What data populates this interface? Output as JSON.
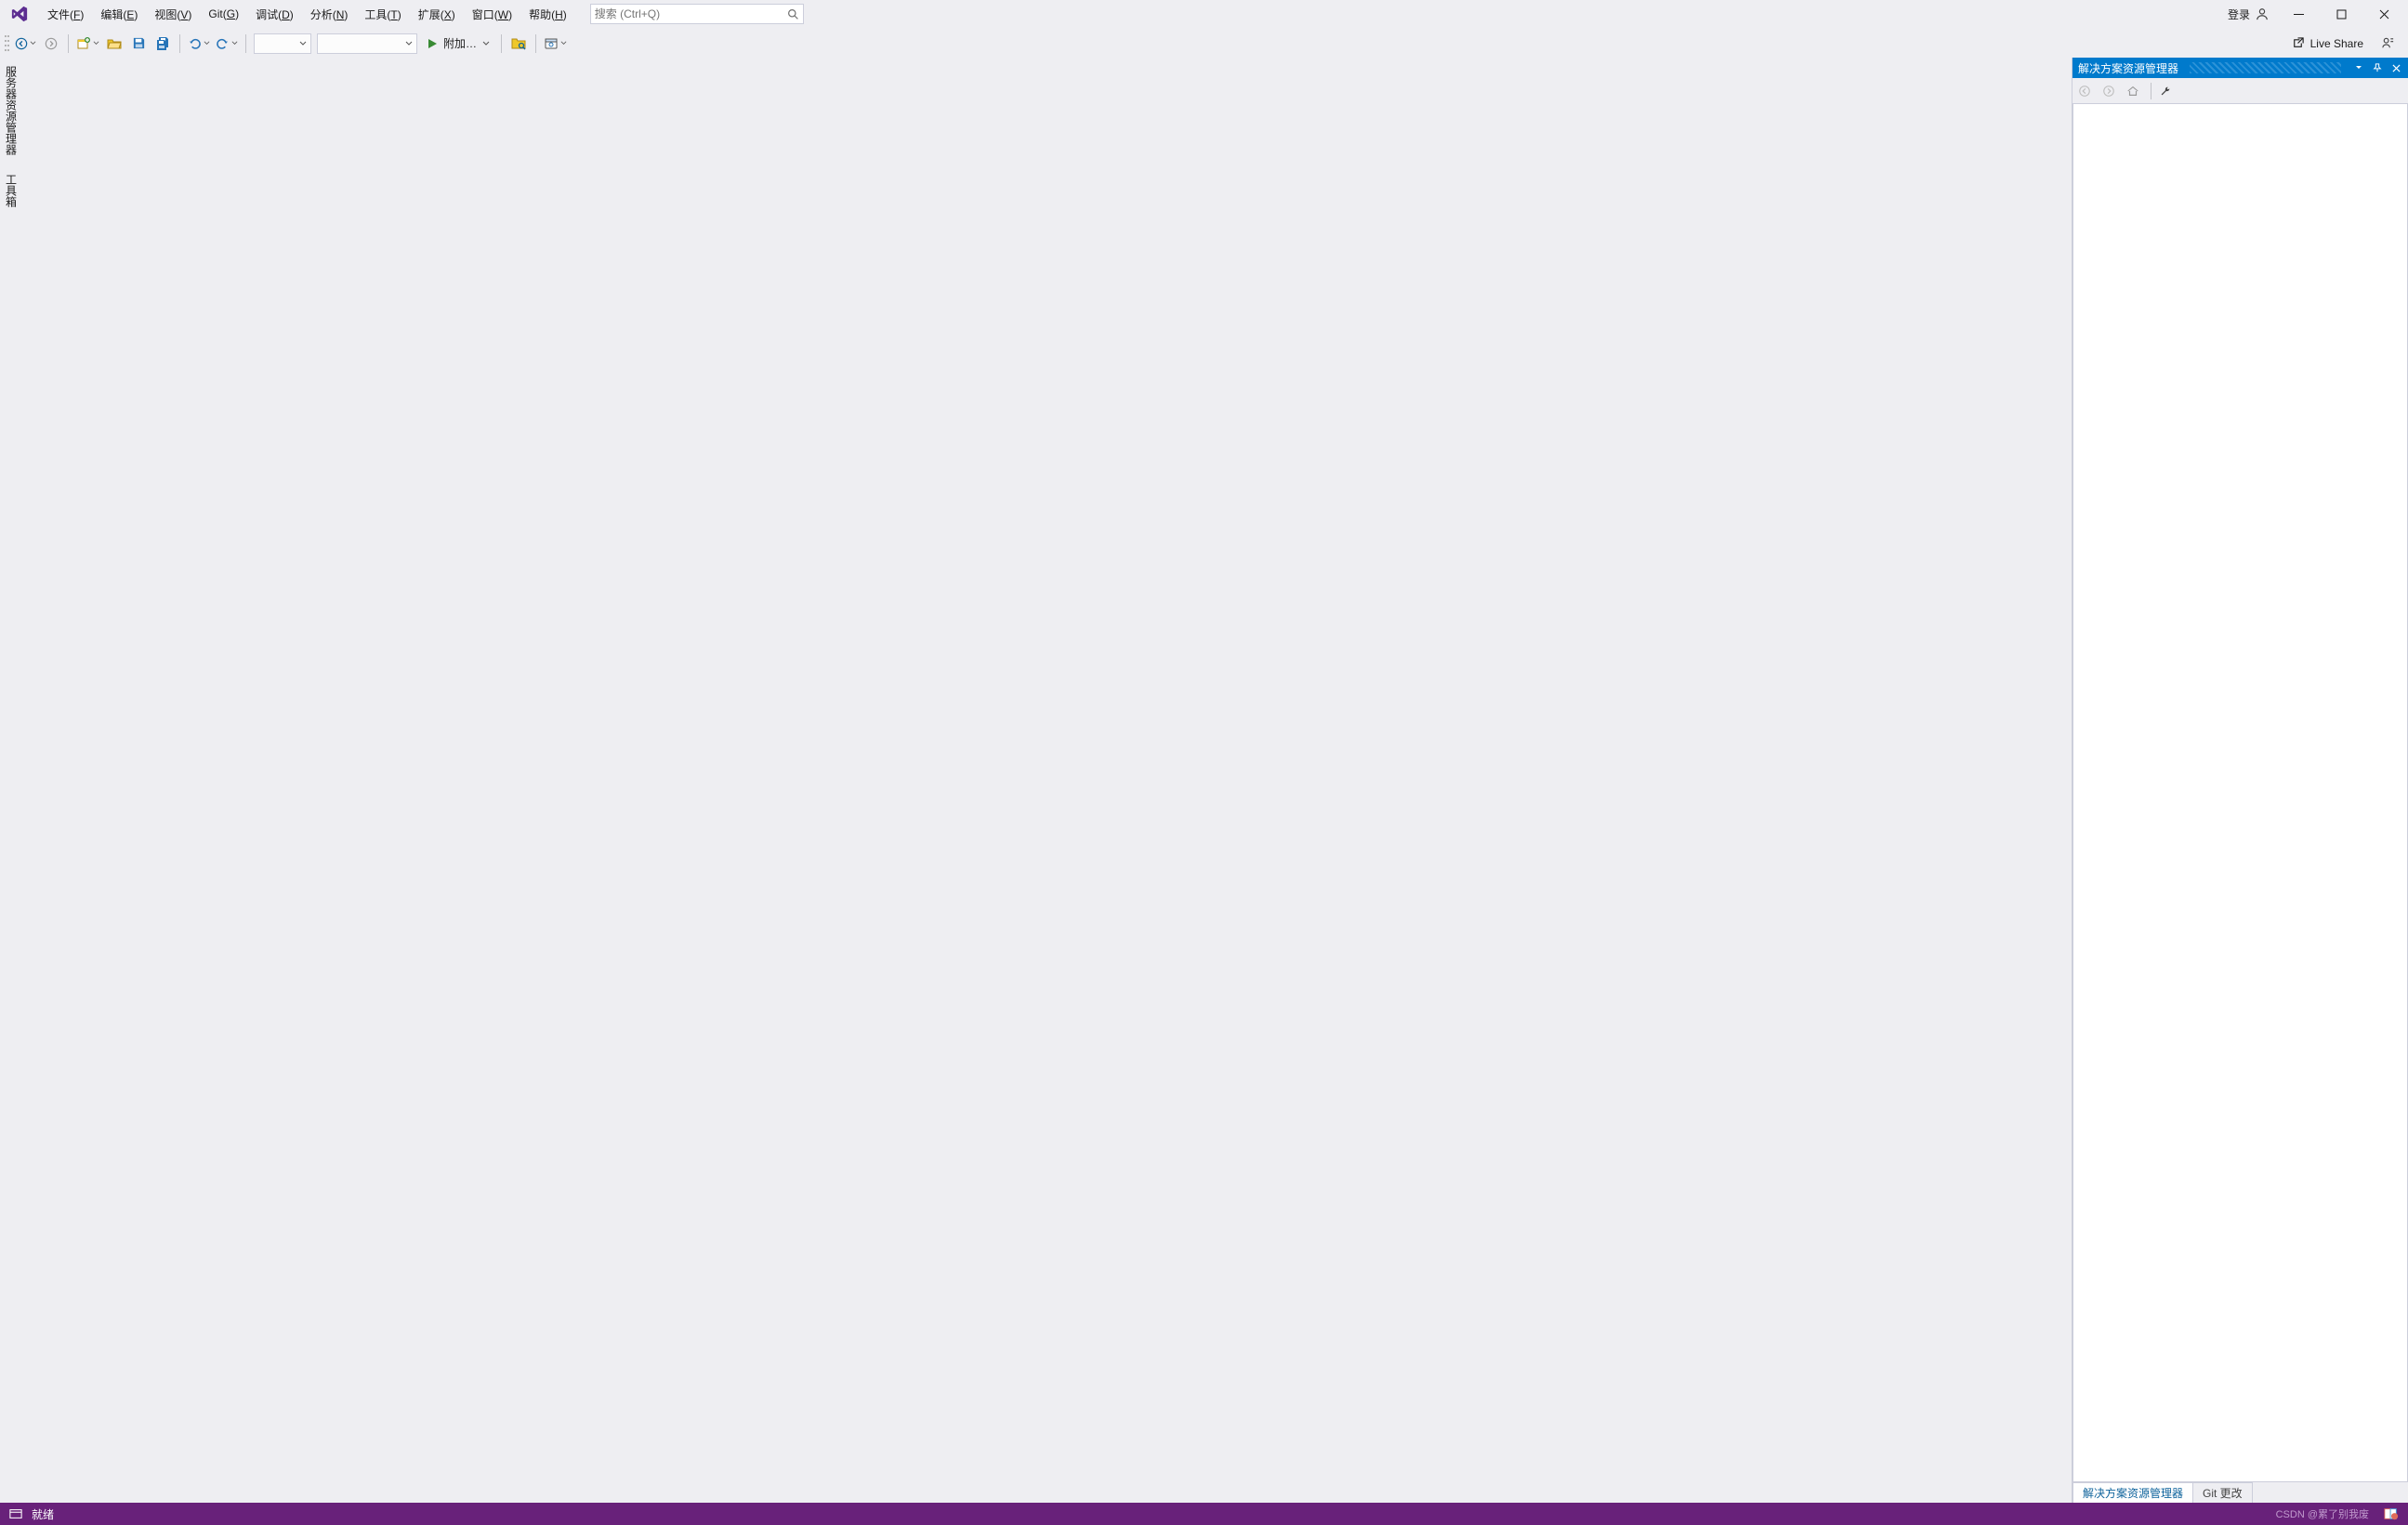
{
  "menubar": {
    "items": [
      {
        "pre": "文件(",
        "u": "F",
        "post": ")"
      },
      {
        "pre": "编辑(",
        "u": "E",
        "post": ")"
      },
      {
        "pre": "视图(",
        "u": "V",
        "post": ")"
      },
      {
        "pre": "Git(",
        "u": "G",
        "post": ")"
      },
      {
        "pre": "调试(",
        "u": "D",
        "post": ")"
      },
      {
        "pre": "分析(",
        "u": "N",
        "post": ")"
      },
      {
        "pre": "工具(",
        "u": "T",
        "post": ")"
      },
      {
        "pre": "扩展(",
        "u": "X",
        "post": ")"
      },
      {
        "pre": "窗口(",
        "u": "W",
        "post": ")"
      },
      {
        "pre": "帮助(",
        "u": "H",
        "post": ")"
      }
    ],
    "search_placeholder": "搜索 (Ctrl+Q)",
    "login": "登录"
  },
  "toolbar": {
    "attach_label": "附加…",
    "live_share": "Live Share"
  },
  "left_dock": {
    "tabs": [
      "服务器资源管理器",
      "工具箱"
    ]
  },
  "solution_explorer": {
    "title": "解决方案资源管理器",
    "tabs": [
      "解决方案资源管理器",
      "Git 更改"
    ]
  },
  "statusbar": {
    "status": "就绪",
    "watermark": "CSDN @累了别我废"
  }
}
